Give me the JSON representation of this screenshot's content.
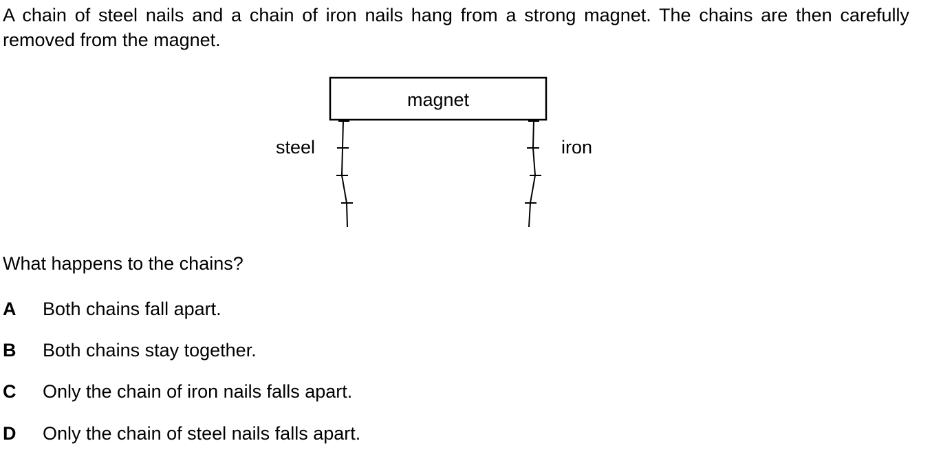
{
  "question": {
    "stem": "A chain of steel nails and a chain of iron nails hang from a strong magnet. The chains are then carefully removed from the magnet.",
    "prompt": "What happens to the chains?"
  },
  "diagram": {
    "magnet_label": "magnet",
    "left_chain_label": "steel",
    "right_chain_label": "iron"
  },
  "options": [
    {
      "letter": "A",
      "text": "Both chains fall apart."
    },
    {
      "letter": "B",
      "text": "Both chains stay together."
    },
    {
      "letter": "C",
      "text": "Only the chain of iron nails falls apart."
    },
    {
      "letter": "D",
      "text": "Only the chain of steel nails falls apart."
    }
  ]
}
